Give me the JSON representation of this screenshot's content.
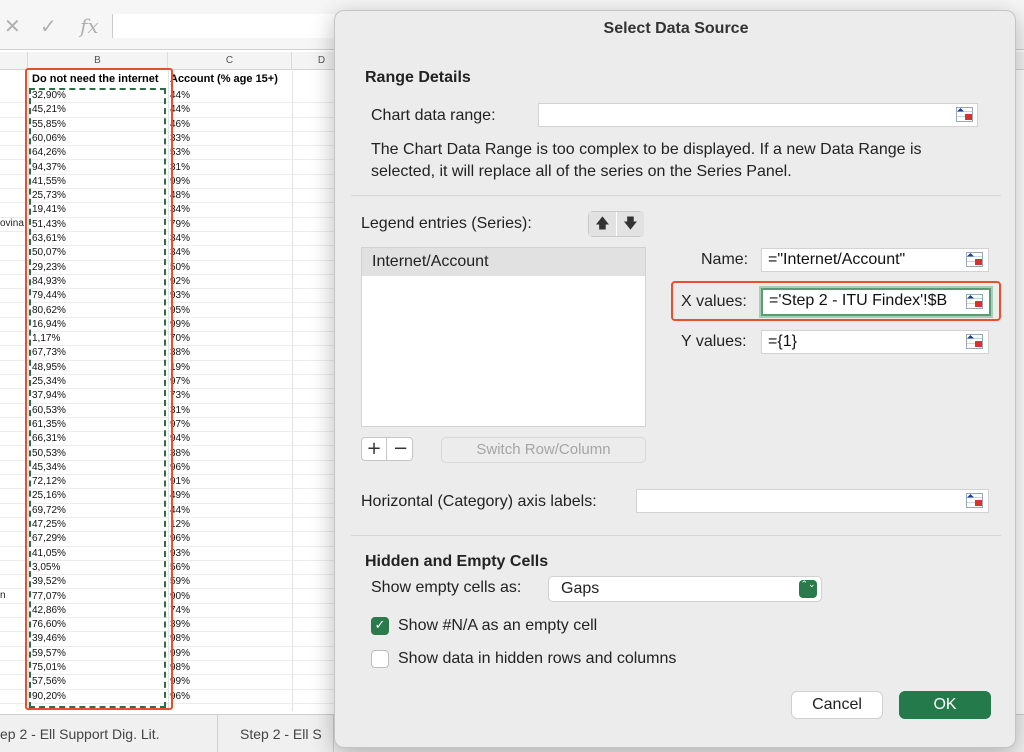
{
  "spreadsheet": {
    "formula_bar": {
      "cancel_icon": "✕",
      "confirm_icon": "✓",
      "fx_label": "fx"
    },
    "column_headers": [
      "B",
      "C",
      "D"
    ],
    "header_b": "Do not need the internet",
    "header_c": "Account (% age 15+)",
    "col_a_fragments": [
      {
        "row": 9,
        "text": "ovina"
      },
      {
        "row": 35,
        "text": "n"
      }
    ],
    "col_b": [
      "32,90%",
      "45,21%",
      "55,85%",
      "60,06%",
      "64,26%",
      "94,37%",
      "41,55%",
      "25,73%",
      "19,41%",
      "51,43%",
      "63,61%",
      "50,07%",
      "29,23%",
      "84,93%",
      "79,44%",
      "80,62%",
      "16,94%",
      "1,17%",
      "67,73%",
      "48,95%",
      "25,34%",
      "37,94%",
      "60,53%",
      "61,35%",
      "66,31%",
      "50,53%",
      "45,34%",
      "72,12%",
      "25,16%",
      "69,72%",
      "47,25%",
      "67,29%",
      "41,05%",
      "3,05%",
      "39,52%",
      "77,07%",
      "42,86%",
      "76,60%",
      "39,46%",
      "59,57%",
      "75,01%",
      "57,56%",
      "90,20%"
    ],
    "col_c": [
      "44%",
      "44%",
      "46%",
      "33%",
      "53%",
      "31%",
      "99%",
      "48%",
      "34%",
      "79%",
      "34%",
      "34%",
      "50%",
      "92%",
      "93%",
      "95%",
      "99%",
      "70%",
      "38%",
      "19%",
      "97%",
      "73%",
      "31%",
      "97%",
      "94%",
      "38%",
      "96%",
      "91%",
      "49%",
      "44%",
      "12%",
      "96%",
      "93%",
      "56%",
      "59%",
      "90%",
      "74%",
      "39%",
      "98%",
      "99%",
      "98%",
      "99%",
      "96%"
    ],
    "sheet_tabs": [
      "ep 2 - Ell Support Dig. Lit.",
      "Step 2 - Ell S"
    ]
  },
  "dialog": {
    "title": "Select Data Source",
    "range_details_title": "Range Details",
    "chart_data_range_label": "Chart data range:",
    "chart_data_range_value": "",
    "description": "The Chart Data Range is too complex to be displayed. If a new Data Range is selected, it will replace all of the series on the Series Panel.",
    "legend_entries_label": "Legend entries (Series):",
    "move_up_icon": "🡅",
    "move_down_icon": "🡇",
    "series": [
      "Internet/Account"
    ],
    "name_label": "Name:",
    "name_value": "=\"Internet/Account\"",
    "x_values_label": "X values:",
    "x_values_value": "='Step 2 - ITU Findex'!$B",
    "y_values_label": "Y values:",
    "y_values_value": "={1}",
    "add_label": "+",
    "remove_label": "−",
    "switch_label": "Switch Row/Column",
    "horizontal_axis_label": "Horizontal (Category) axis labels:",
    "horizontal_axis_value": "",
    "hidden_empty_title": "Hidden and Empty Cells",
    "show_empty_label": "Show empty cells as:",
    "show_empty_value": "Gaps",
    "stepper_icon": "⌃⌄",
    "checkbox_na_label": "Show #N/A as an empty cell",
    "checkbox_na_checked": true,
    "checkbox_hidden_label": "Show data in hidden rows and columns",
    "checkbox_hidden_checked": false,
    "check_icon": "✓",
    "cancel_label": "Cancel",
    "ok_label": "OK"
  },
  "colors": {
    "highlight_red": "#e8502d",
    "accent_green": "#247a4a",
    "marquee_green": "#2f6e45"
  }
}
